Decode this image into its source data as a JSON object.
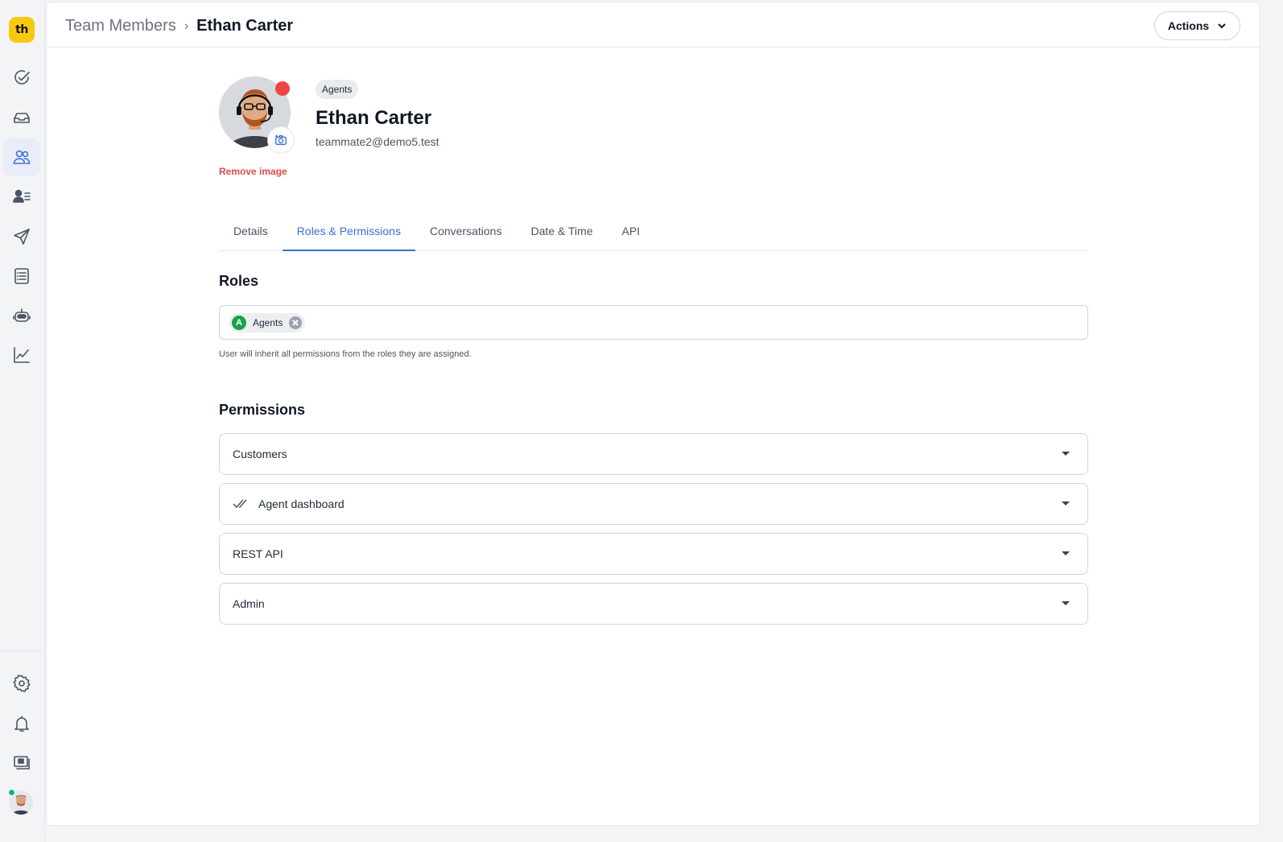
{
  "app": {
    "logo_text": "th",
    "accent_color": "#3b6fd4",
    "logo_color": "#f6c90e"
  },
  "sidebar": {
    "items": [
      {
        "icon": "check-circle-icon",
        "label": "Tasks"
      },
      {
        "icon": "inbox-icon",
        "label": "Inbox"
      },
      {
        "icon": "users-icon",
        "label": "Team",
        "active": true
      },
      {
        "icon": "contacts-icon",
        "label": "Contacts"
      },
      {
        "icon": "send-icon",
        "label": "Campaigns"
      },
      {
        "icon": "knowledge-base-icon",
        "label": "Knowledge base"
      },
      {
        "icon": "bot-icon",
        "label": "Bots"
      },
      {
        "icon": "reports-icon",
        "label": "Reports"
      }
    ],
    "bottom": [
      {
        "icon": "gear-icon"
      },
      {
        "icon": "bell-icon"
      },
      {
        "icon": "billing-icon"
      }
    ]
  },
  "header": {
    "breadcrumb_root": "Team Members",
    "breadcrumb_current": "Ethan Carter",
    "actions_label": "Actions"
  },
  "profile": {
    "role_badge": "Agents",
    "name": "Ethan Carter",
    "email": "teammate2@demo5.test",
    "remove_image_label": "Remove image",
    "status_color": "#ef4444"
  },
  "tabs": [
    {
      "label": "Details",
      "active": false
    },
    {
      "label": "Roles & Permissions",
      "active": true
    },
    {
      "label": "Conversations",
      "active": false
    },
    {
      "label": "Date & Time",
      "active": false
    },
    {
      "label": "API",
      "active": false
    }
  ],
  "roles": {
    "title": "Roles",
    "chips": [
      {
        "initial": "A",
        "label": "Agents"
      }
    ],
    "help_text": "User will inherit all permissions from the roles they are assigned."
  },
  "permissions": {
    "title": "Permissions",
    "items": [
      {
        "label": "Customers",
        "icon": null
      },
      {
        "label": "Agent dashboard",
        "icon": "double-check-icon"
      },
      {
        "label": "REST API",
        "icon": null
      },
      {
        "label": "Admin",
        "icon": null
      }
    ]
  }
}
